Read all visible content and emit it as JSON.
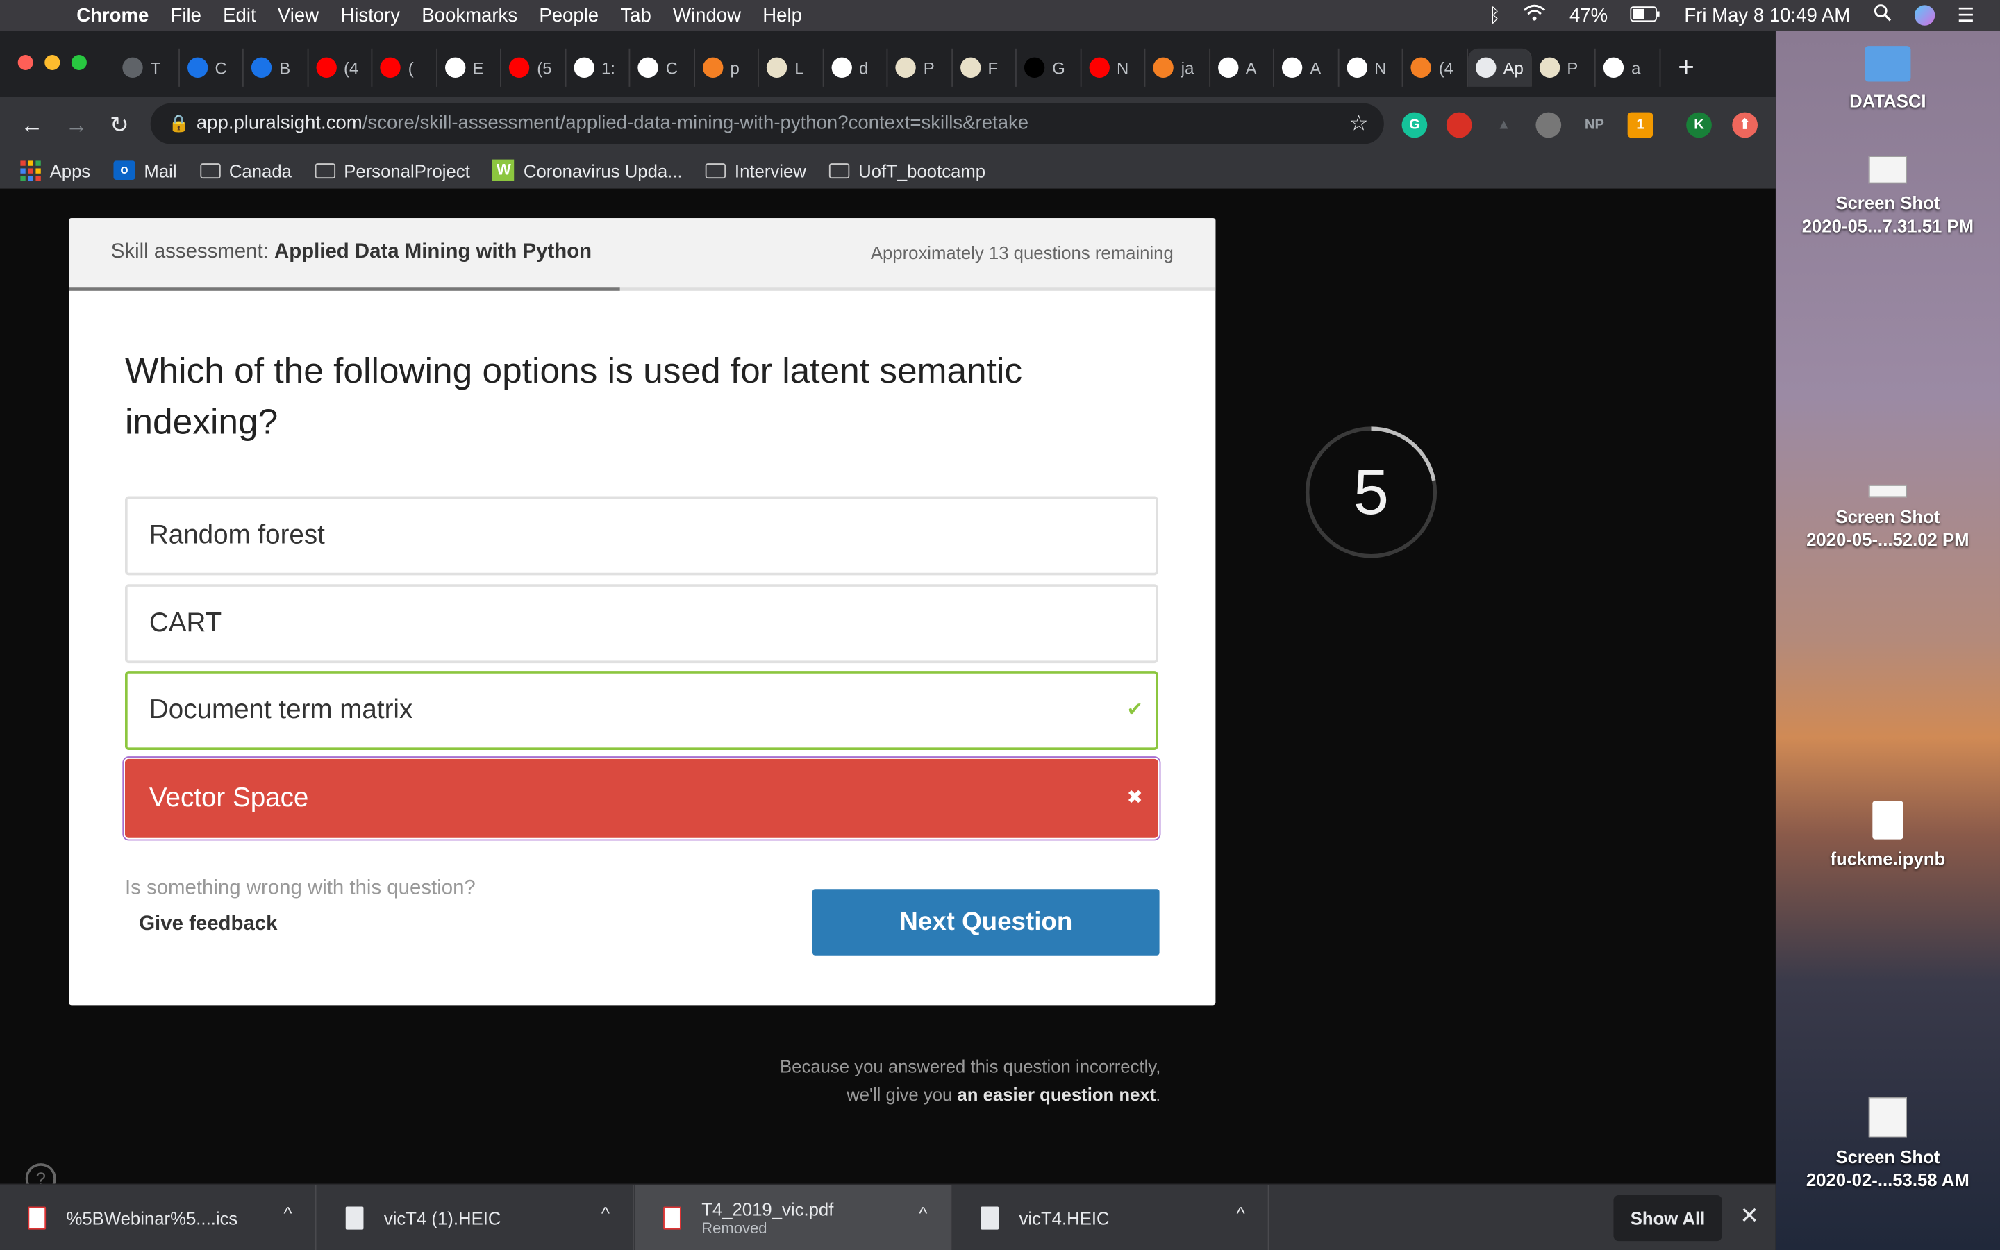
{
  "menubar": {
    "app": "Chrome",
    "items": [
      "File",
      "Edit",
      "View",
      "History",
      "Bookmarks",
      "People",
      "Tab",
      "Window",
      "Help"
    ],
    "battery": "47%",
    "datetime": "Fri May 8  10:49 AM"
  },
  "tabs": [
    {
      "title": "T",
      "color": "#5f6368"
    },
    {
      "title": "C",
      "color": "#1a73e8"
    },
    {
      "title": "B",
      "color": "#1a73e8"
    },
    {
      "title": "(4",
      "color": "#ff0000"
    },
    {
      "title": "(",
      "color": "#ff0000"
    },
    {
      "title": "E",
      "color": "#ffffff"
    },
    {
      "title": "(5",
      "color": "#ff0000"
    },
    {
      "title": "1:",
      "color": "#ffffff"
    },
    {
      "title": "C",
      "color": "#ffffff"
    },
    {
      "title": "p",
      "color": "#f48024"
    },
    {
      "title": "L",
      "color": "#e8e0c8"
    },
    {
      "title": "d",
      "color": "#ffffff"
    },
    {
      "title": "P",
      "color": "#e8e0c8"
    },
    {
      "title": "F",
      "color": "#e8e0c8"
    },
    {
      "title": "G",
      "color": "#000000"
    },
    {
      "title": "N",
      "color": "#ff0000"
    },
    {
      "title": "ja",
      "color": "#f48024"
    },
    {
      "title": "A",
      "color": "#ffffff"
    },
    {
      "title": "A",
      "color": "#ffffff"
    },
    {
      "title": "N",
      "color": "#ffffff"
    },
    {
      "title": "(4",
      "color": "#f48024"
    },
    {
      "title": "Ap",
      "color": "#e8eaed",
      "active": true
    },
    {
      "title": "P",
      "color": "#e8e0c8"
    },
    {
      "title": "a",
      "color": "#ffffff"
    }
  ],
  "address": {
    "host": "app.pluralsight.com",
    "path": "/score/skill-assessment/applied-data-mining-with-python?context=skills&retake"
  },
  "extensions": [
    "G",
    "",
    "",
    "",
    "NP",
    "1",
    "K",
    ""
  ],
  "bookmarks": [
    "Apps",
    "Mail",
    "Canada",
    "PersonalProject",
    "Coronavirus Upda...",
    "Interview",
    "UofT_bootcamp"
  ],
  "assessment": {
    "prefix": "Skill assessment:",
    "name": "Applied Data Mining with Python",
    "remaining": "Approximately 13 questions remaining",
    "progress": 0.48,
    "question": "Which of the following options is used for latent semantic indexing?",
    "options": [
      {
        "label": "Random forest",
        "state": "none"
      },
      {
        "label": "CART",
        "state": "none"
      },
      {
        "label": "Document term matrix",
        "state": "correct"
      },
      {
        "label": "Vector Space",
        "state": "wrong"
      }
    ],
    "feedback_prompt": "Is something wrong with this question?",
    "feedback_link": "Give feedback",
    "next_label": "Next Question",
    "note_line1": "Because you answered this question incorrectly,",
    "note_line2_pre": "we'll give you",
    "note_line2_bold": "an easier question next",
    "note_line2_post": ".",
    "timer": "5",
    "timer_fraction": 0.22,
    "help": "?"
  },
  "downloads": [
    {
      "name": "%5BWebinar%5....ics",
      "status": ""
    },
    {
      "name": "vicT4 (1).HEIC",
      "status": ""
    },
    {
      "name": "T4_2019_vic.pdf",
      "status": "Removed"
    },
    {
      "name": "vicT4.HEIC",
      "status": ""
    }
  ],
  "downloads_show_all": "Show All",
  "desktop": [
    {
      "label1": "DATASCI",
      "label2": ""
    },
    {
      "label1": "Screen Shot",
      "label2": "2020-05...7.31.51 PM"
    },
    {
      "label1": "Screen Shot",
      "label2": "2020-05-...52.02 PM"
    },
    {
      "label1": "fuckme.ipynb",
      "label2": ""
    },
    {
      "label1": "Screen Shot",
      "label2": "2020-02-...53.58 AM"
    }
  ]
}
